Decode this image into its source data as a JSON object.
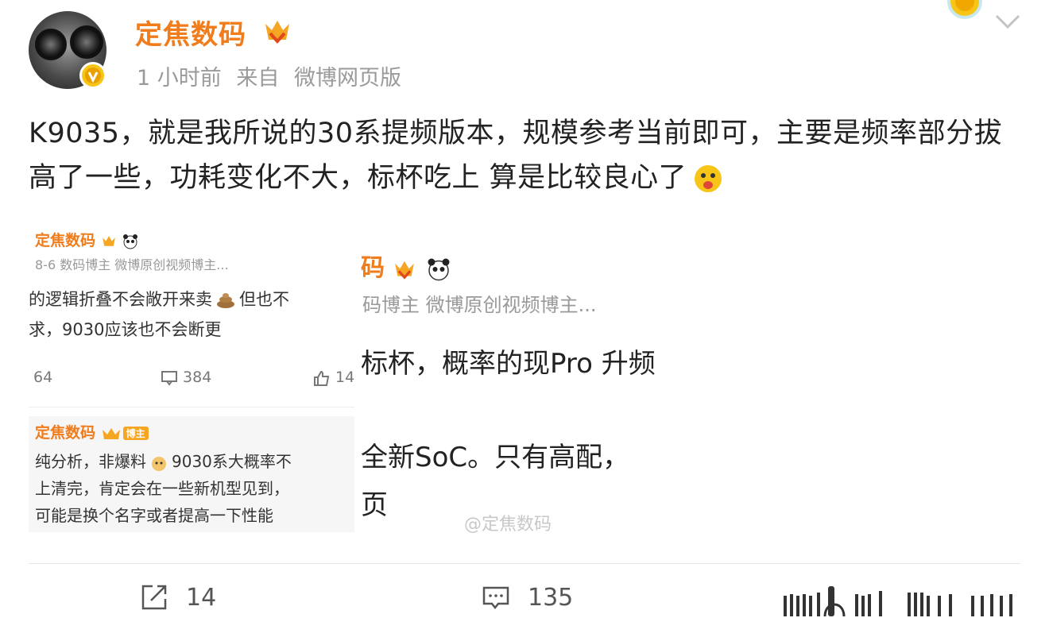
{
  "post": {
    "author": "定焦数码",
    "time": "1 小时前",
    "source_prefix": "来自",
    "source": "微博网页版",
    "text": "K9035，就是我所说的30系提频版本，规模参考当前即可，主要是频率部分拔高了一些，功耗变化不大，标杯吃上 算是比较良心了"
  },
  "screenshot_left": {
    "name": "定焦数码",
    "meta": "8-6  数码博主 微博原创视频博主...",
    "line1": "的逻辑折叠不会敞开来卖",
    "line1b": "但也不",
    "line2": "求，9030应该也不会断更",
    "repost_count": "64",
    "comment_count": "384",
    "like_count": "14",
    "reply_name": "定焦数码",
    "reply_tag": "博主",
    "reply_line1": "纯分析，非爆料",
    "reply_line1b": "9030系大概率不",
    "reply_line2": "上清完，肯定会在一些新机型见到，",
    "reply_line3": "可能是换个名字或者提高一下性能"
  },
  "screenshot_right": {
    "name": "码",
    "meta": "码博主 微博原创视频博主...",
    "line1": "标杯，概率的现Pro 升频",
    "line2": "全新SoC。只有高配，",
    "line3": "页"
  },
  "watermark": "@定焦数码",
  "actions": {
    "share_count": "14",
    "comment_count": "135"
  },
  "colors": {
    "username": "#f07c1c",
    "meta": "#9a9a9a",
    "badge": "#f7c518"
  }
}
